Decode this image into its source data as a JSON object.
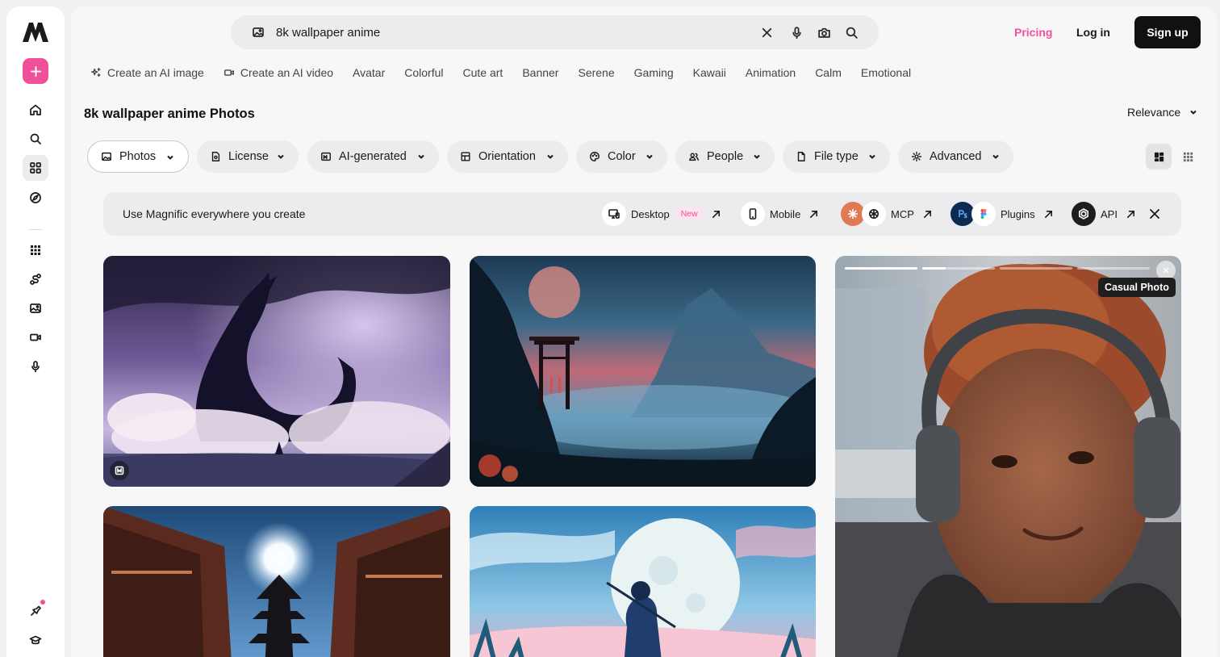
{
  "brand": {
    "accent": "#f0509a"
  },
  "sidebar": {
    "items": [
      {
        "icon": "home-icon"
      },
      {
        "icon": "search-icon"
      },
      {
        "icon": "grid-icon"
      },
      {
        "icon": "compass-icon"
      },
      {
        "icon": "apps-icon"
      },
      {
        "icon": "workflow-icon"
      },
      {
        "icon": "image-edit-icon"
      },
      {
        "icon": "video-icon"
      },
      {
        "icon": "microphone-icon"
      },
      {
        "icon": "notification-icon"
      },
      {
        "icon": "learn-icon"
      }
    ]
  },
  "search": {
    "value": "8k wallpaper anime",
    "placeholder": "Search"
  },
  "header": {
    "pricing": "Pricing",
    "login": "Log in",
    "signup": "Sign up"
  },
  "chips": [
    "Create an AI image",
    "Create an AI video",
    "Avatar",
    "Colorful",
    "Cute art",
    "Banner",
    "Serene",
    "Gaming",
    "Kawaii",
    "Animation",
    "Calm",
    "Emotional"
  ],
  "page": {
    "title": "8k wallpaper anime Photos",
    "sort": "Relevance"
  },
  "filters": [
    "Photos",
    "License",
    "AI-generated",
    "Orientation",
    "Color",
    "People",
    "File type",
    "Advanced"
  ],
  "banner": {
    "text": "Use Magnific everywhere you create",
    "items": [
      "Desktop",
      "Mobile",
      "MCP",
      "Plugins",
      "API"
    ],
    "new_badge": "New"
  },
  "cards": {
    "tooltip": "Casual Photo",
    "video_progress": 0.33
  }
}
